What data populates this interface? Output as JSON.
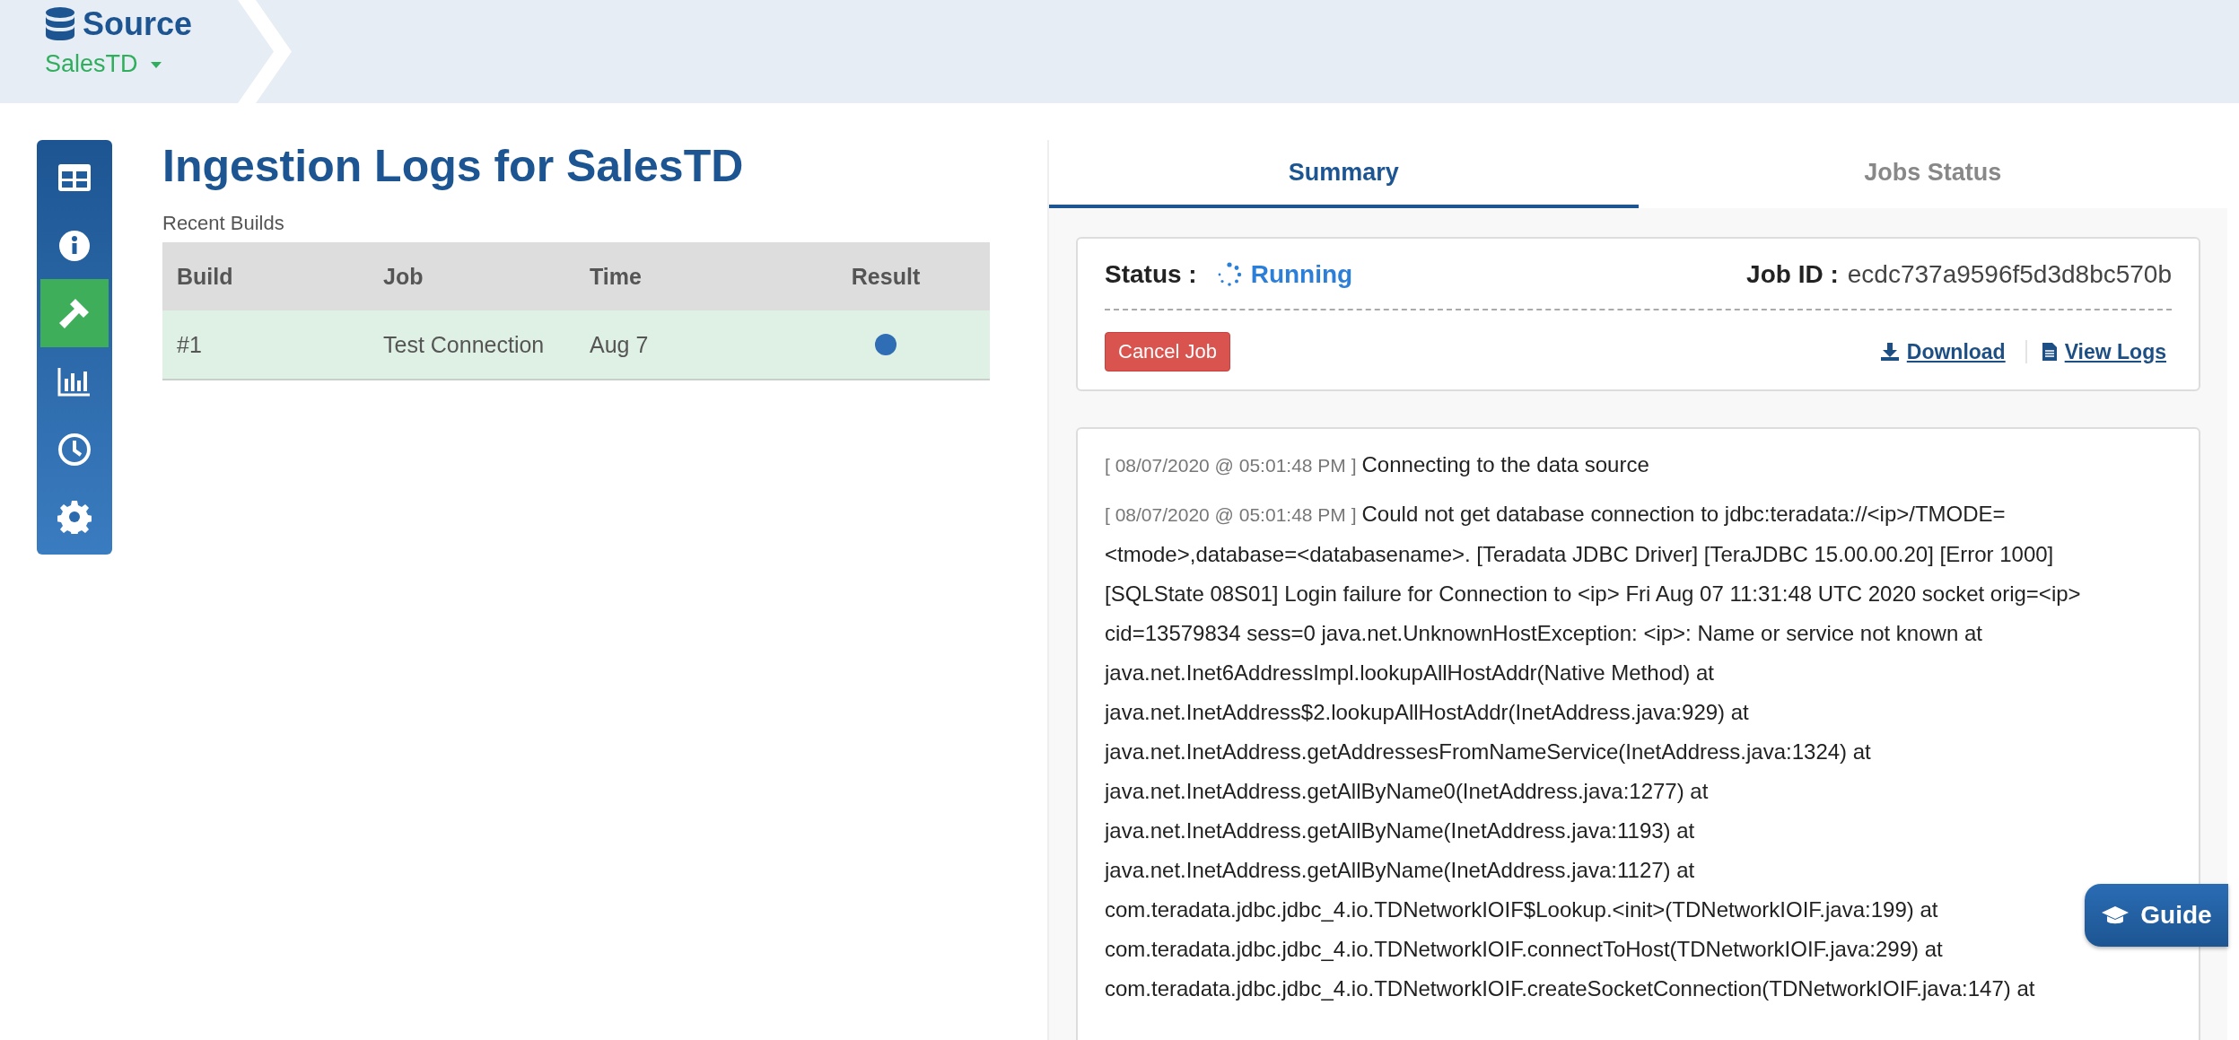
{
  "header": {
    "title": "Source",
    "source_name": "SalesTD"
  },
  "sidebar": {
    "items": [
      {
        "kind": "table",
        "selected": false
      },
      {
        "kind": "info",
        "selected": false
      },
      {
        "kind": "hammer",
        "selected": true
      },
      {
        "kind": "chart",
        "selected": false
      },
      {
        "kind": "clock",
        "selected": false
      },
      {
        "kind": "gear",
        "selected": false
      }
    ]
  },
  "page_title": "Ingestion Logs for SalesTD",
  "builds": {
    "caption": "Recent Builds",
    "columns": [
      "Build",
      "Job",
      "Time",
      "Result"
    ],
    "rows": [
      {
        "build": "#1",
        "job": "Test Connection",
        "time": "Aug 7",
        "color": "#2f6db5"
      }
    ]
  },
  "tabs": [
    {
      "label": "Summary",
      "selected": true
    },
    {
      "label": "Jobs Status",
      "selected": false
    }
  ],
  "job": {
    "status_label": "Status :",
    "status": "Running",
    "job_id_label": "Job ID :",
    "job_id": "ecdc737a9596f5d3d8bc570b",
    "cancel": "Cancel Job",
    "links": [
      {
        "kind": "download",
        "label": "Download"
      },
      {
        "kind": "document",
        "label": "View Logs"
      }
    ]
  },
  "log": [
    {
      "timestamp": "[ 08/07/2020 @ 05:01:48 PM ]",
      "lines": [
        "Connecting to the data source"
      ]
    },
    {
      "timestamp": "[ 08/07/2020 @ 05:01:48 PM ]",
      "lines": [
        "Could not get database connection to jdbc:teradata://<ip>/TMODE=",
        "<tmode>,database=<databasename>. [Teradata JDBC Driver] [TeraJDBC 15.00.00.20] [Error 1000]",
        "[SQLState 08S01] Login failure for Connection to <ip> Fri Aug 07 11:31:48 UTC 2020 socket orig=<ip>",
        "cid=13579834 sess=0 java.net.UnknownHostException: <ip>: Name or service not known at",
        "java.net.Inet6AddressImpl.lookupAllHostAddr(Native Method) at",
        "java.net.InetAddress$2.lookupAllHostAddr(InetAddress.java:929) at",
        "java.net.InetAddress.getAddressesFromNameService(InetAddress.java:1324) at",
        "java.net.InetAddress.getAllByName0(InetAddress.java:1277) at",
        "java.net.InetAddress.getAllByName(InetAddress.java:1193) at",
        "java.net.InetAddress.getAllByName(InetAddress.java:1127) at",
        "com.teradata.jdbc.jdbc_4.io.TDNetworkIOIF$Lookup.<init>(TDNetworkIOIF.java:199) at",
        "com.teradata.jdbc.jdbc_4.io.TDNetworkIOIF.connectToHost(TDNetworkIOIF.java:299) at",
        "com.teradata.jdbc.jdbc_4.io.TDNetworkIOIF.createSocketConnection(TDNetworkIOIF.java:147) at"
      ]
    }
  ],
  "guide": {
    "label": "Guide"
  }
}
